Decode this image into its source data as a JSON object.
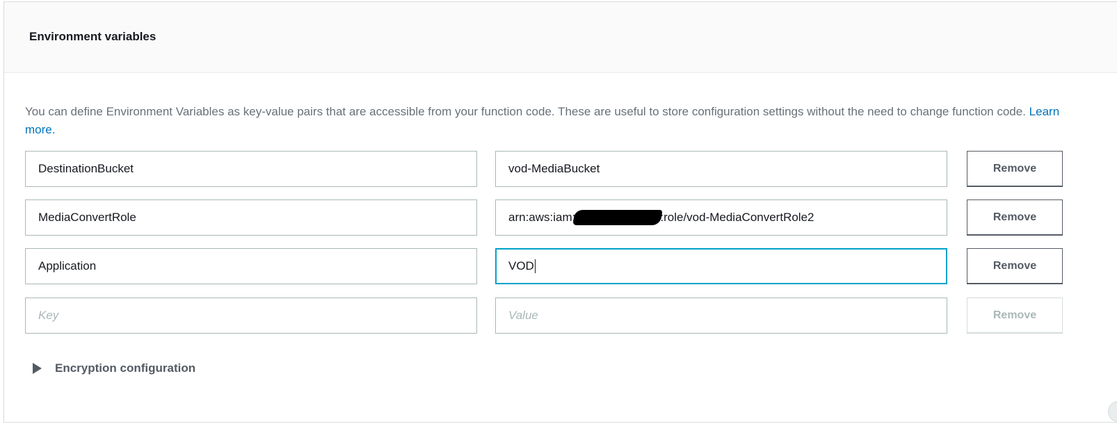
{
  "panel": {
    "title": "Environment variables",
    "description": "You can define Environment Variables as key-value pairs that are accessible from your function code. These are useful to store configuration settings without the need to change function code.",
    "learn_more": "Learn more."
  },
  "variables": [
    {
      "key": "DestinationBucket",
      "value": "vod-MediaBucket",
      "remove_label": "Remove"
    },
    {
      "key": "MediaConvertRole",
      "value_prefix": "arn:aws:iam:",
      "value_suffix": ":role/vod-MediaConvertRole2",
      "remove_label": "Remove"
    },
    {
      "key": "Application",
      "value": "VOD",
      "remove_label": "Remove"
    }
  ],
  "new_row": {
    "key_placeholder": "Key",
    "value_placeholder": "Value",
    "remove_label": "Remove"
  },
  "encryption": {
    "label": "Encryption configuration"
  },
  "colors": {
    "link": "#0073bb",
    "focus": "#00a1c9",
    "border": "#aab7b8",
    "button_text": "#545b64"
  }
}
